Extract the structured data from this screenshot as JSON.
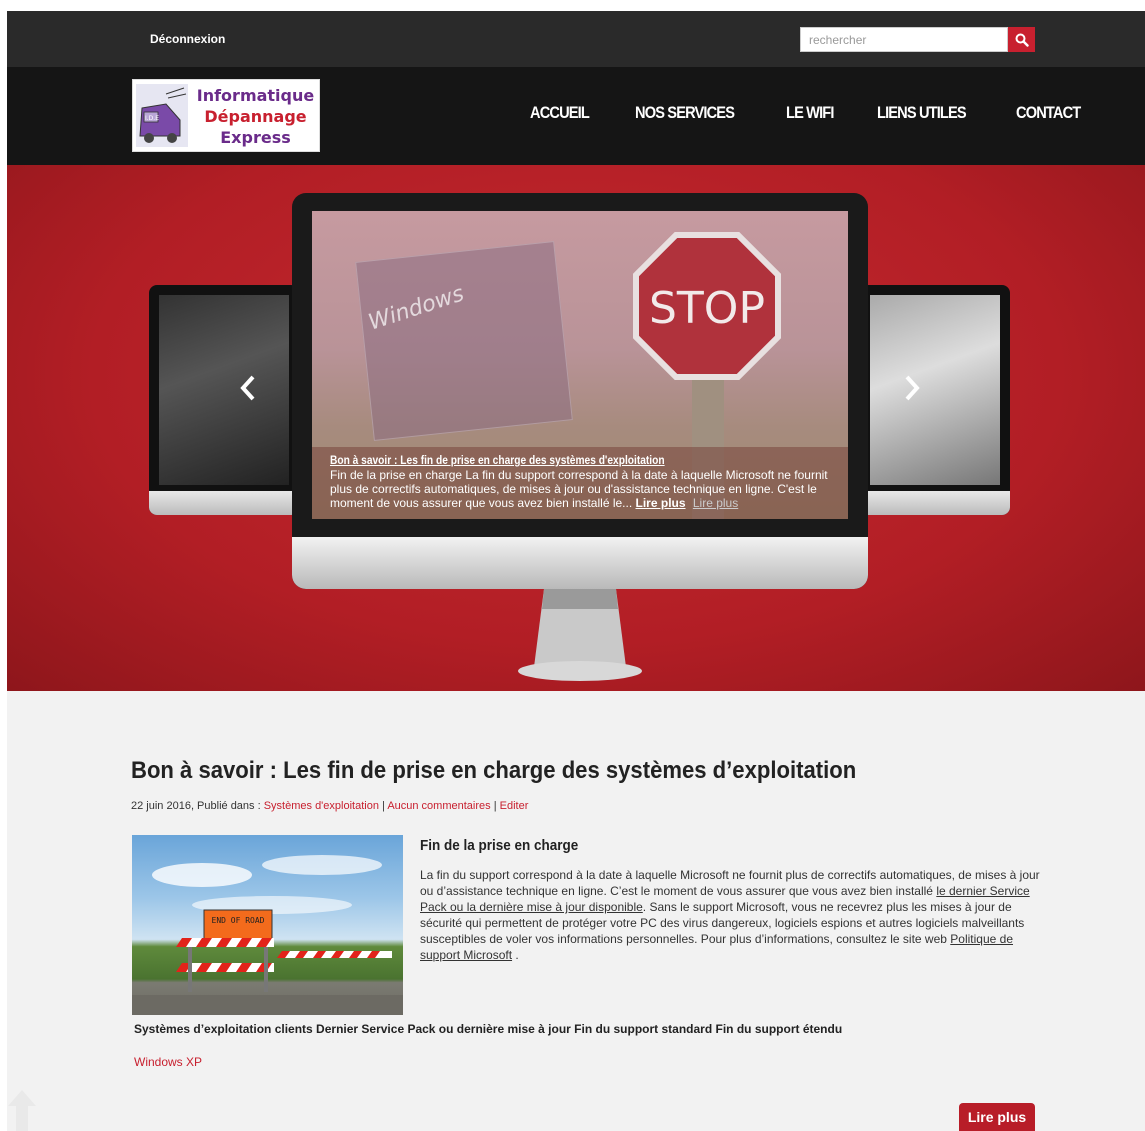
{
  "topbar": {
    "logout_label": "Déconnexion",
    "search_placeholder": "rechercher"
  },
  "logo": {
    "emblem_text": "I.D.E",
    "line1": "Informatique",
    "line2": "Dépannage",
    "line3": "Express"
  },
  "nav": {
    "items": [
      {
        "label": "ACCUEIL"
      },
      {
        "label": "NOS SERVICES"
      },
      {
        "label": "LE WIFI"
      },
      {
        "label": "LIENS UTILES"
      },
      {
        "label": "CONTACT"
      }
    ]
  },
  "slider": {
    "screen_text": "STOP",
    "windows_text": "Windows",
    "caption_title": "Bon à savoir : Les fin de prise en charge des systèmes d'exploitation",
    "caption_text": "Fin de la prise en charge La fin du support correspond à la date à laquelle Microsoft ne fournit plus de correctifs automatiques, de mises à jour ou d'assistance technique en ligne. C'est le moment de vous assurer que vous avez bien installé le...",
    "caption_more": "Lire plus",
    "caption_more2": "Lire plus"
  },
  "post": {
    "title": "Bon à savoir : Les fin de prise en charge des systèmes d’exploitation",
    "meta_prefix": "22 juin 2016, Publié dans : ",
    "meta_category": "Systèmes d'exploitation",
    "meta_sep1": " | ",
    "meta_comments": "Aucun commentaires",
    "meta_sep2": " | ",
    "meta_edit": "Editer",
    "image_sign": "END OF ROAD",
    "section_title": "Fin de la prise en charge",
    "body_part1": "La fin du support correspond à la date à laquelle Microsoft ne fournit plus de correctifs automatiques, de mises à jour ou d’assistance technique en ligne. C’est le moment de vous assurer que vous avez bien installé ",
    "body_link1": "le dernier Service Pack ou la dernière mise à jour disponible",
    "body_part2": ". Sans le support Microsoft, vous ne recevrez plus les mises à jour de sécurité qui permettent de protéger votre PC des virus dangereux, logiciels espions et autres logiciels malveillants susceptibles de voler vos informations personnelles. Pour plus d’informations, consultez le site web ",
    "body_link2": "Politique de support Microsoft",
    "body_part3": " .",
    "table_header": "Systèmes d’exploitation clients Dernier Service Pack ou dernière mise à jour Fin du support standard Fin du support étendu",
    "table_first_item": "Windows XP",
    "read_more": "Lire plus"
  },
  "colors": {
    "accent": "#c8202f",
    "topbar": "#2a2a2a",
    "header": "#151515",
    "hero": "#b21e25"
  }
}
